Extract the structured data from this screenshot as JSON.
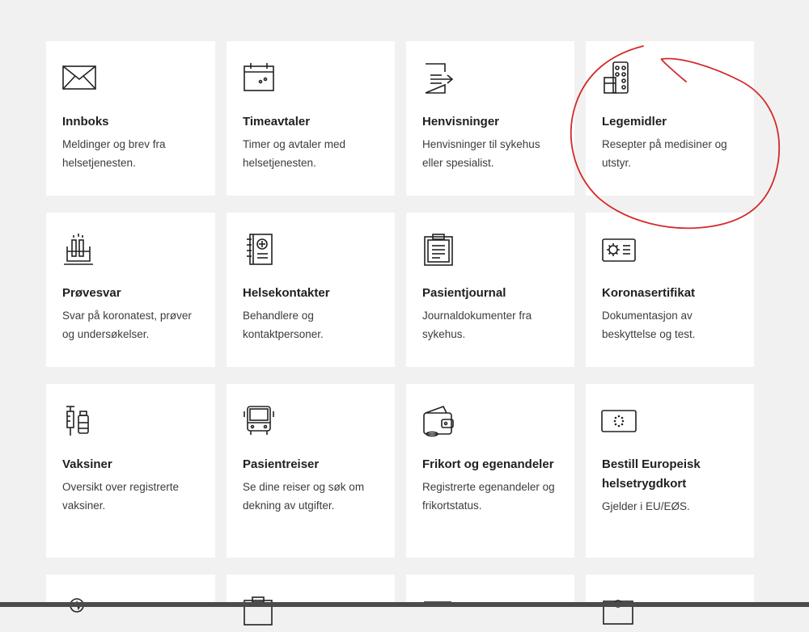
{
  "cards": [
    {
      "title": "Innboks",
      "description": "Meldinger og brev fra helsetjenesten.",
      "icon": "envelope-icon"
    },
    {
      "title": "Timeavtaler",
      "description": "Timer og avtaler med helsetjenesten.",
      "icon": "calendar-icon"
    },
    {
      "title": "Henvisninger",
      "description": "Henvisninger til sykehus eller spesialist.",
      "icon": "referral-document-icon"
    },
    {
      "title": "Legemidler",
      "description": "Resepter på medisiner og utstyr.",
      "icon": "medicine-pills-icon"
    },
    {
      "title": "Prøvesvar",
      "description": "Svar på koronatest, prøver og undersøkelser.",
      "icon": "test-tubes-icon"
    },
    {
      "title": "Helsekontakter",
      "description": "Behandlere og kontaktpersoner.",
      "icon": "contacts-book-icon"
    },
    {
      "title": "Pasientjournal",
      "description": "Journaldokumenter fra sykehus.",
      "icon": "clipboard-icon"
    },
    {
      "title": "Koronasertifikat",
      "description": "Dokumentasjon av beskyttelse og test.",
      "icon": "corona-certificate-icon"
    },
    {
      "title": "Vaksiner",
      "description": "Oversikt over registrerte vaksiner.",
      "icon": "syringe-vial-icon"
    },
    {
      "title": "Pasientreiser",
      "description": "Se dine reiser og søk om dekning av utgifter.",
      "icon": "bus-icon"
    },
    {
      "title": "Frikort og egenandeler",
      "description": "Registrerte egenandeler og frikortstatus.",
      "icon": "wallet-icon"
    },
    {
      "title": "Bestill Europeisk helsetrygdkort",
      "description": "Gjelder i EU/EØS.",
      "icon": "eu-card-icon"
    }
  ],
  "partial_row_icons": [
    "heartbeat-icon",
    "briefcase-icon",
    "folder-icon",
    "id-card-icon"
  ],
  "colors": {
    "background": "#f2f1f1",
    "card": "#ffffff",
    "annotation": "#d42a2a"
  }
}
